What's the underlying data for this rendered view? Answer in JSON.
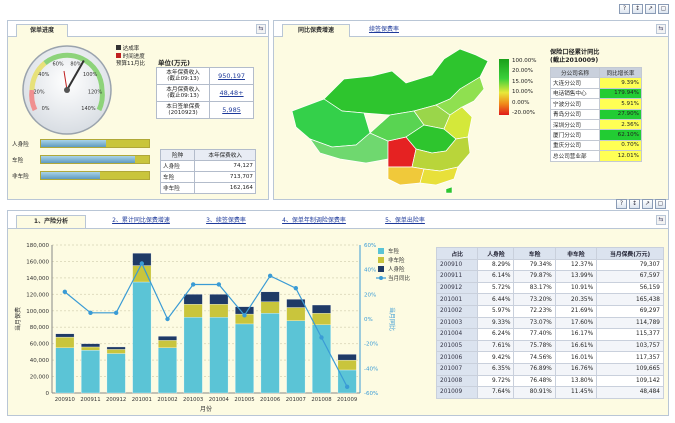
{
  "window_buttons": [
    "?",
    "↕",
    "↗",
    "▢"
  ],
  "top_left": {
    "tabs": {
      "active": "保单进度"
    },
    "gauge": {
      "legend": [
        "达成率",
        "时间进度"
      ],
      "subtitle": "预算11月比",
      "ticks": [
        "0%",
        "20%",
        "40%",
        "60%",
        "80%",
        "100%",
        "120%",
        "140%"
      ],
      "value": 0.86
    },
    "info": {
      "unit": "单位(万元)",
      "rows": [
        {
          "label": "本年保费收入\n(截止09:13)",
          "value": "950,197"
        },
        {
          "label": "本月保费收入\n(截止09:13)",
          "value": "48,48+"
        },
        {
          "label": "本日签单保费\n(2010923)",
          "value": "5,985"
        }
      ]
    },
    "bars": [
      {
        "label": "人身险",
        "progress": 0.6
      },
      {
        "label": "车险",
        "progress": 0.87
      },
      {
        "label": "非车险",
        "progress": 0.55
      }
    ],
    "product_table": {
      "headers": [
        "险种",
        "本年保费收入"
      ],
      "rows": [
        [
          "人身险",
          "74,127"
        ],
        [
          "车险",
          "713,707"
        ],
        [
          "非车险",
          "162,164"
        ]
      ]
    }
  },
  "top_right": {
    "tabs": [
      "同比保费增速",
      "续签保费率"
    ],
    "map_legend": [
      "100.00%",
      "20.00%",
      "15.00%",
      "10.00%",
      "0.00%",
      "-20.00%"
    ],
    "ranking": {
      "title": "保险口径累计同比\n(截止2010009)",
      "headers": [
        "分公司名称",
        "同比增长率"
      ],
      "rows": [
        [
          "大连分公司",
          "9.39%"
        ],
        [
          "电话销售中心",
          "179.94%"
        ],
        [
          "宁波分公司",
          "5.91%"
        ],
        [
          "青岛分公司",
          "27.90%"
        ],
        [
          "深圳分公司",
          "2.36%"
        ],
        [
          "厦门分公司",
          "62.10%"
        ],
        [
          "重庆分公司",
          "0.70%"
        ],
        [
          "总公司营业部",
          "12.01%"
        ]
      ],
      "colors": [
        "#ffff55",
        "#22cc33",
        "#ffff55",
        "#22cc33",
        "#ffff55",
        "#22cc33",
        "#ffff55",
        "#ffff55"
      ]
    }
  },
  "bottom": {
    "tabs": [
      "1、产险分析",
      "2、累计同比保费增速",
      "3、续签保费率",
      "4、保单年制调险保费率",
      "5、保单出险率"
    ],
    "chart_data": {
      "type": "bar",
      "categories": [
        "200910",
        "200911",
        "200912",
        "201001",
        "201002",
        "201003",
        "201004",
        "201005",
        "201006",
        "201007",
        "201008",
        "201009"
      ],
      "series": [
        {
          "name": "车险",
          "values": [
            55000,
            52000,
            48000,
            135000,
            55000,
            92000,
            92000,
            84000,
            97000,
            88000,
            83000,
            28000
          ]
        },
        {
          "name": "非车险",
          "values": [
            13000,
            4000,
            5000,
            20000,
            9000,
            16000,
            16000,
            12000,
            14000,
            16000,
            14000,
            12000
          ]
        },
        {
          "name": "人身险",
          "values": [
            4000,
            4000,
            3000,
            15000,
            5000,
            12000,
            12000,
            9000,
            12000,
            10000,
            10000,
            7000
          ]
        },
        {
          "name": "当月同比",
          "values": [
            22,
            5,
            5,
            45,
            0,
            28,
            28,
            3,
            35,
            25,
            -15,
            -55
          ]
        }
      ],
      "xlabel": "月份",
      "ylabel": "当月保费",
      "y2label": "当月同比",
      "yticks": [
        "0",
        "20,000",
        "40,000",
        "60,000",
        "80,000",
        "100,000",
        "120,000",
        "140,000",
        "160,000",
        "180,000"
      ],
      "y2ticks": [
        "-60%",
        "-40%",
        "-20%",
        "0%",
        "20%",
        "40%",
        "60%"
      ],
      "ylim": [
        0,
        180000
      ],
      "y2lim": [
        -60,
        60
      ],
      "colors": {
        "车险": "#5bc4d6",
        "非车险": "#c9c53c",
        "人身险": "#1f3a66",
        "当月同比": "#3a9bd5"
      }
    },
    "table": {
      "headers": [
        "占比",
        "人身险",
        "车险",
        "非车险",
        "当月保费(万元)"
      ],
      "rows": [
        [
          "200910",
          "8.29%",
          "79.34%",
          "12.37%",
          "79,307"
        ],
        [
          "200911",
          "6.14%",
          "79.87%",
          "13.99%",
          "67,597"
        ],
        [
          "200912",
          "5.72%",
          "83.17%",
          "10.91%",
          "56,159"
        ],
        [
          "201001",
          "6.44%",
          "73.20%",
          "20.35%",
          "165,438"
        ],
        [
          "201002",
          "5.97%",
          "72.23%",
          "21.69%",
          "69,297"
        ],
        [
          "201003",
          "9.33%",
          "73.07%",
          "17.60%",
          "114,789"
        ],
        [
          "201004",
          "6.24%",
          "77.40%",
          "16.17%",
          "115,377"
        ],
        [
          "201005",
          "7.61%",
          "75.78%",
          "16.61%",
          "103,757"
        ],
        [
          "201006",
          "9.42%",
          "74.56%",
          "16.01%",
          "117,357"
        ],
        [
          "201007",
          "6.35%",
          "76.89%",
          "16.76%",
          "109,665"
        ],
        [
          "201008",
          "9.72%",
          "76.48%",
          "13.80%",
          "109,142"
        ],
        [
          "201009",
          "7.64%",
          "80.91%",
          "11.45%",
          "48,484"
        ]
      ]
    }
  }
}
